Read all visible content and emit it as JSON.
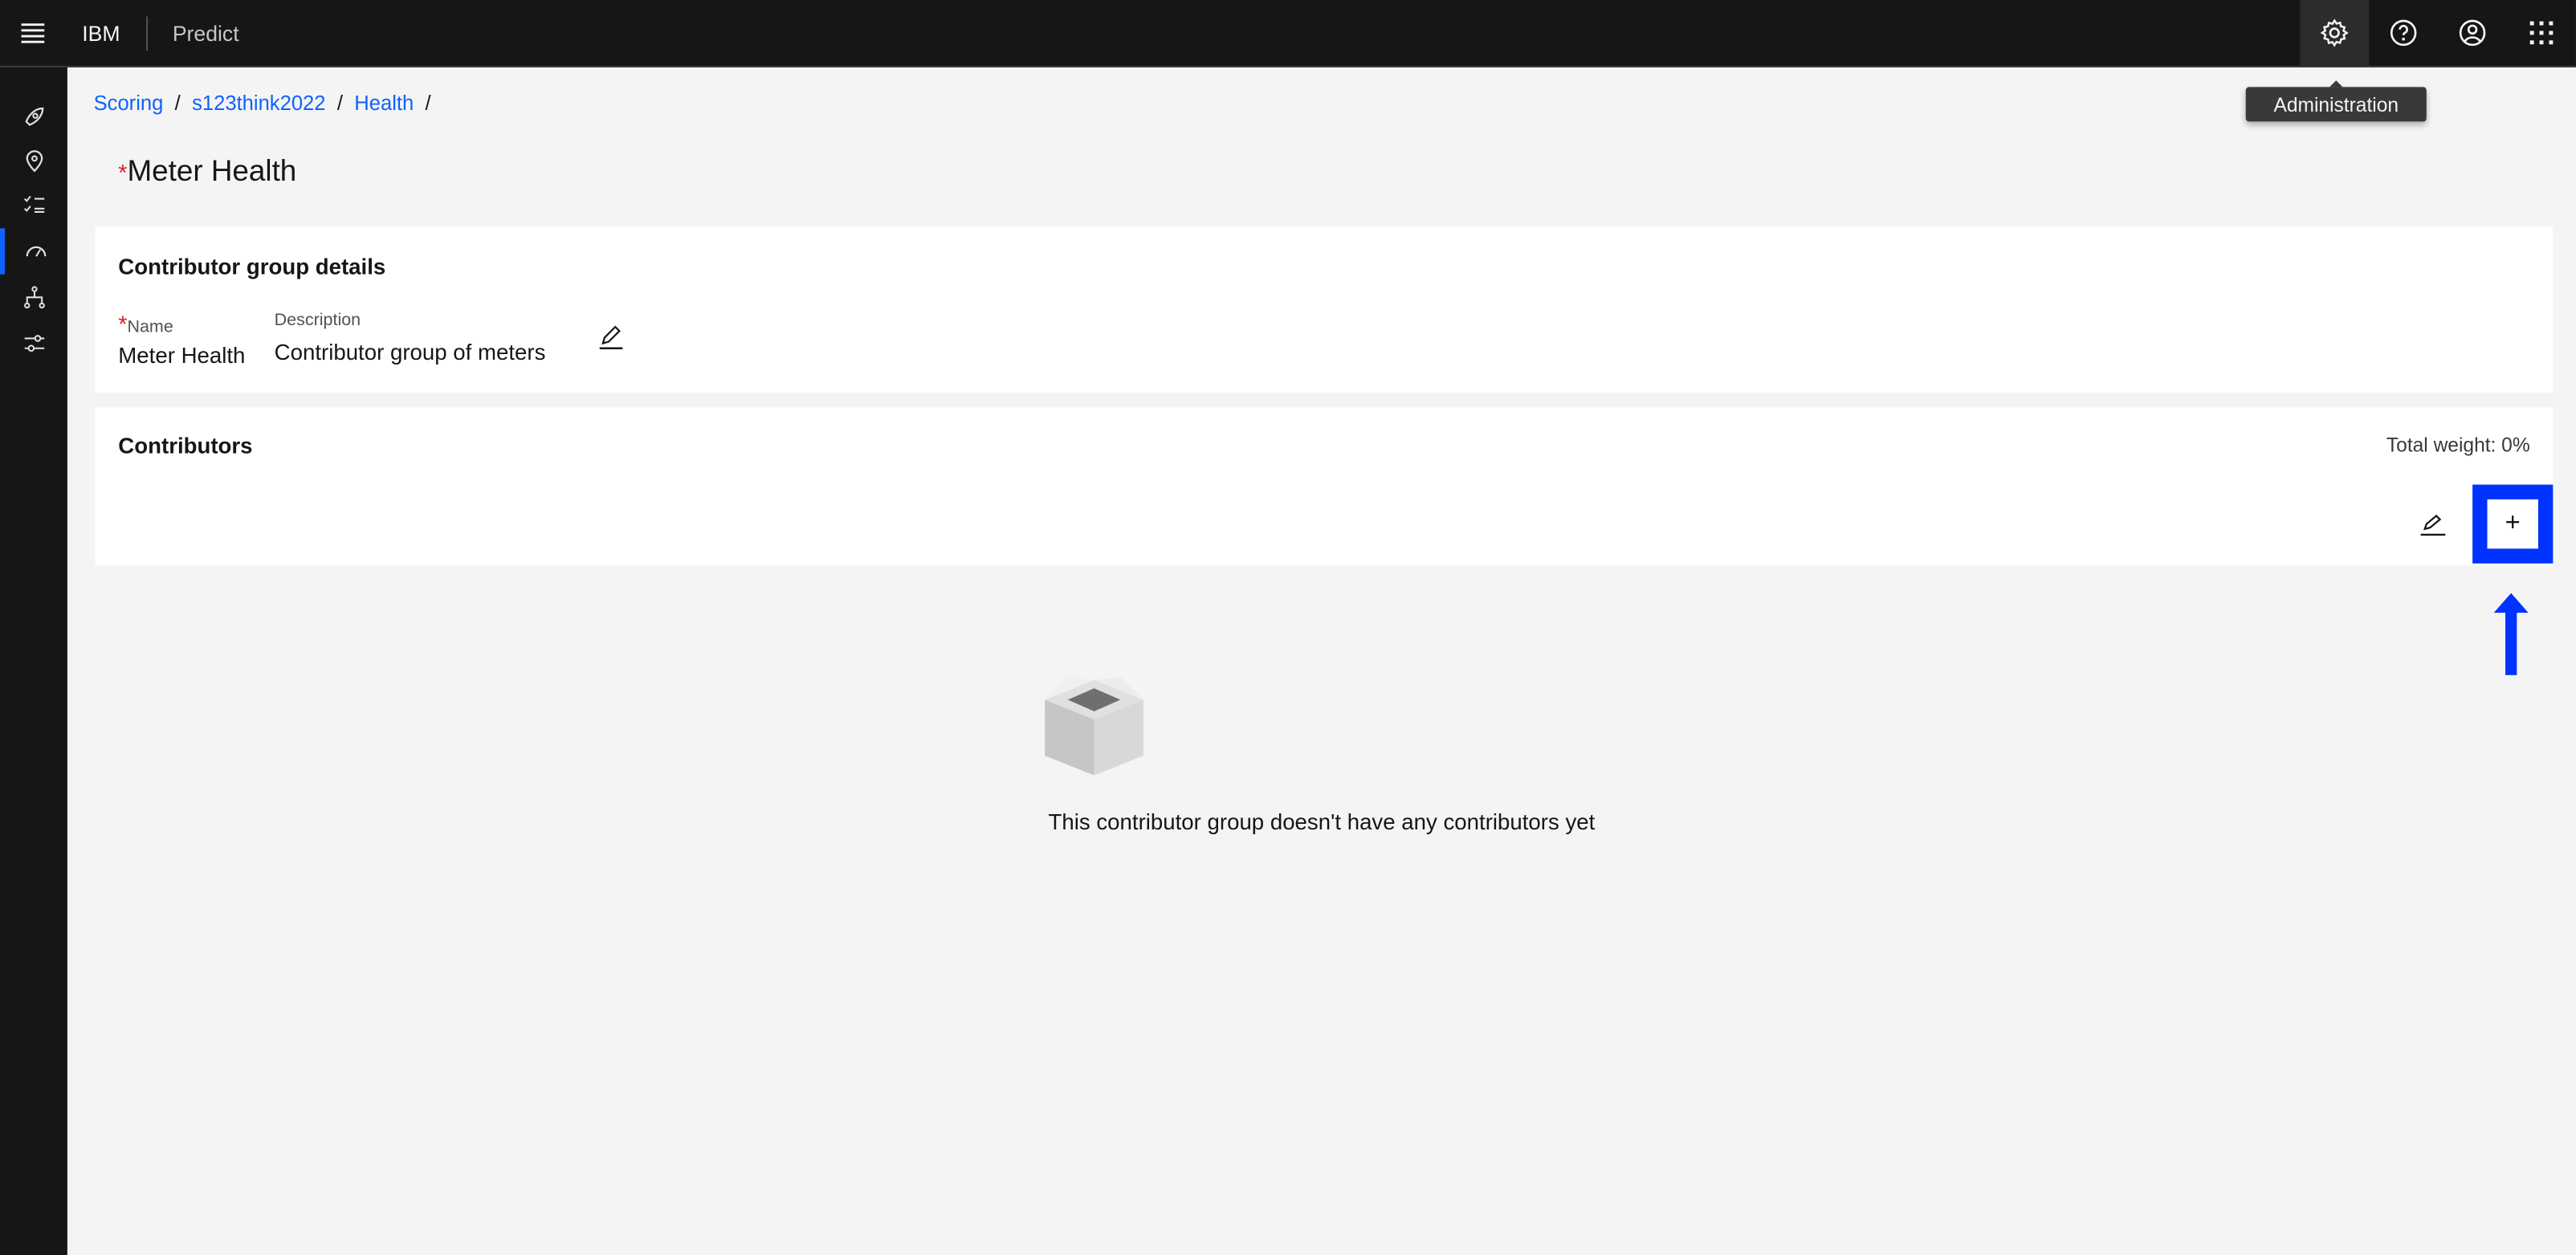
{
  "header": {
    "brand": "IBM",
    "product": "Predict",
    "tooltip": "Administration"
  },
  "breadcrumb": [
    {
      "label": "Scoring"
    },
    {
      "label": "s123think2022"
    },
    {
      "label": "Health"
    }
  ],
  "breadcrumb_sep": "/",
  "page": {
    "required_mark": "*",
    "title": "Meter Health"
  },
  "details": {
    "heading": "Contributor group details",
    "name_label": "Name",
    "name_value": "Meter Health",
    "description_label": "Description",
    "description_value": "Contributor group of meters"
  },
  "contributors": {
    "heading": "Contributors",
    "total_weight": "Total weight: 0%",
    "add_label": "+",
    "empty_message": "This contributor group doesn't have any contributors yet"
  },
  "colors": {
    "header": "#161616",
    "accent": "#0f62fe",
    "highlight": "#0033ff",
    "required": "#da1e28"
  }
}
